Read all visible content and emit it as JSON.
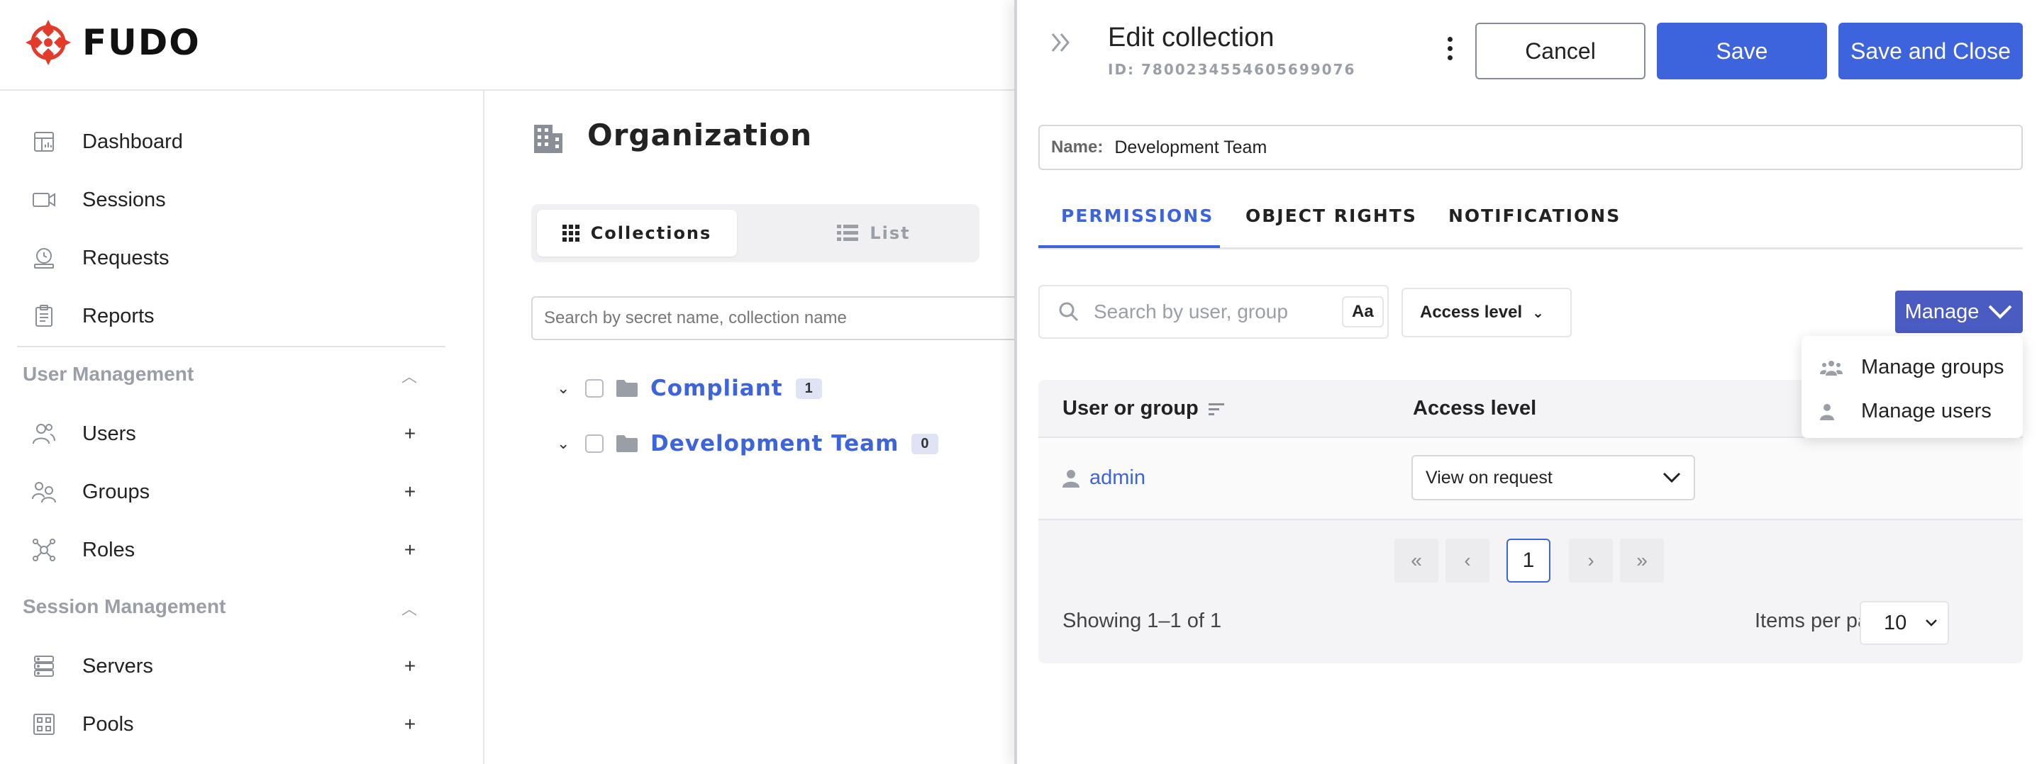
{
  "app": {
    "brand": "FUDO",
    "brand_color": "#e33b2a",
    "accent_color": "#3d63dd"
  },
  "sidebar": {
    "items": [
      {
        "label": "Dashboard",
        "icon": "dashboard-icon"
      },
      {
        "label": "Sessions",
        "icon": "video-camera-icon"
      },
      {
        "label": "Requests",
        "icon": "timer-icon"
      },
      {
        "label": "Reports",
        "icon": "clipboard-icon"
      }
    ],
    "sections": [
      {
        "title": "User Management",
        "items": [
          {
            "label": "Users",
            "icon": "users-icon",
            "action": "+"
          },
          {
            "label": "Groups",
            "icon": "groups-icon",
            "action": "+"
          },
          {
            "label": "Roles",
            "icon": "roles-icon",
            "action": "+"
          }
        ]
      },
      {
        "title": "Session Management",
        "items": [
          {
            "label": "Servers",
            "icon": "servers-icon",
            "action": "+"
          },
          {
            "label": "Pools",
            "icon": "pools-icon",
            "action": "+"
          }
        ]
      }
    ]
  },
  "main": {
    "title": "Organization",
    "views": {
      "collections": "Collections",
      "list": "List"
    },
    "search_placeholder": "Search by secret name, collection name",
    "tree": [
      {
        "name": "Compliant",
        "count": "1"
      },
      {
        "name": "Development Team",
        "count": "0"
      }
    ]
  },
  "panel": {
    "title": "Edit collection",
    "id_text": "ID: 7800234554605699076",
    "buttons": {
      "cancel": "Cancel",
      "save": "Save",
      "save_close": "Save and Close"
    },
    "name_label": "Name:",
    "name_value": "Development Team",
    "tabs": [
      "PERMISSIONS",
      "OBJECT RIGHTS",
      "NOTIFICATIONS"
    ],
    "search_placeholder": "Search by user, group",
    "case_toggle": "Aa",
    "access_filter": "Access level",
    "manage": {
      "label": "Manage",
      "items": [
        "Manage groups",
        "Manage users"
      ]
    },
    "table": {
      "headers": {
        "user": "User or group",
        "access": "Access level"
      },
      "rows": [
        {
          "user": "admin",
          "access": "View on request"
        }
      ]
    },
    "pagination": {
      "first": "«",
      "prev": "‹",
      "current": "1",
      "next": "›",
      "last": "»"
    },
    "showing": "Showing 1–1 of 1",
    "items_per_page_label": "Items per page:",
    "items_per_page": "10"
  }
}
